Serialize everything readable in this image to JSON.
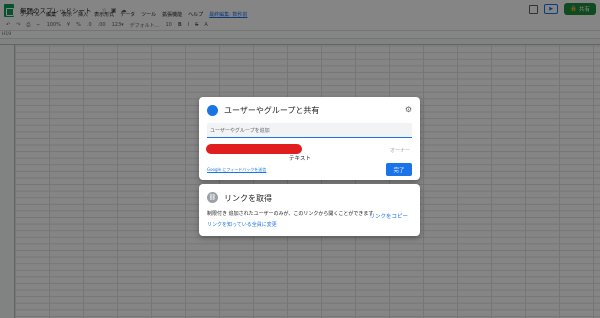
{
  "header": {
    "doc_title": "無題のスプレッドシート",
    "share_label": "共有"
  },
  "menu": [
    "ファイル",
    "編集",
    "表示",
    "挿入",
    "表示形式",
    "データ",
    "ツール",
    "拡張機能",
    "ヘルプ",
    "最終編集: 数秒前"
  ],
  "toolbar": {
    "zoom": "100%",
    "currency": "¥",
    "percent": "%",
    "decimal1": ".0",
    "decimal2": ".00",
    "number_format": "123▾",
    "font": "デフォルト...",
    "font_size": "10"
  },
  "formula_bar": {
    "cell_ref": "H19"
  },
  "share_dialog": {
    "title": "ユーザーやグループと共有",
    "add_placeholder": "ユーザーやグループを追加",
    "overlay_text": "テキスト",
    "owner_label": "オーナー",
    "feedback_link": "Google にフィードバックを送信",
    "done_label": "完了"
  },
  "link_dialog": {
    "title": "リンクを取得",
    "restriction_text": "制限付き 追加されたユーザーのみが、このリンクから開くことができます",
    "change_link": "リンクを知っている全員に変更",
    "copy_link": "リンクをコピー"
  }
}
